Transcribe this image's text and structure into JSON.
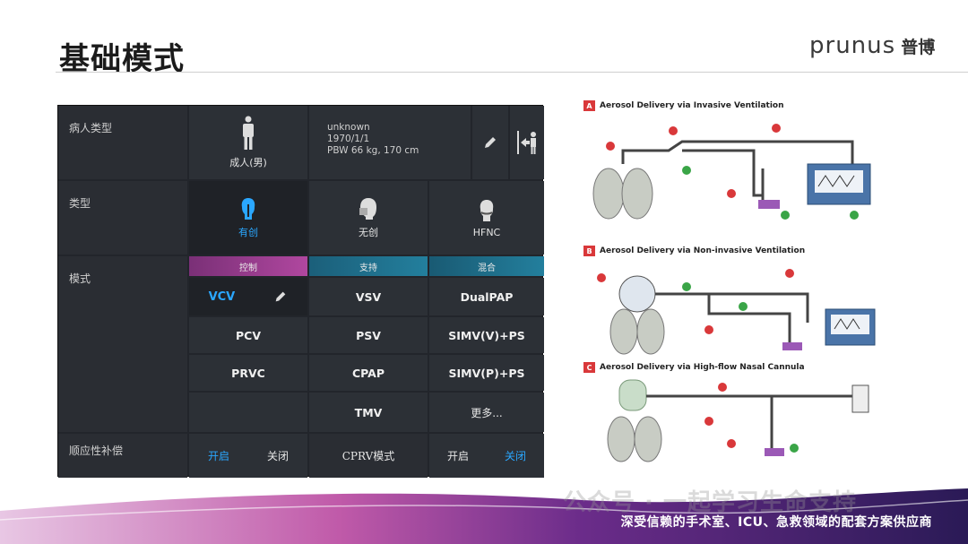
{
  "slide": {
    "title": "基础模式",
    "logo_latin": "prunus",
    "logo_cn": "普博",
    "footer": "深受信赖的手术室、ICU、急救领域的配套方案供应商",
    "watermark": "公众号 · 一起学习生命支持"
  },
  "panel": {
    "row_labels": {
      "patient_type": "病人类型",
      "type": "类型",
      "mode": "模式",
      "compliance": "顺应性补偿"
    },
    "patient": {
      "label": "成人(男)",
      "name": "unknown",
      "dob": "1970/1/1",
      "pbw": "PBW 66 kg, 170 cm"
    },
    "types": [
      "有创",
      "无创",
      "HFNC"
    ],
    "mode_headers": [
      "控制",
      "支持",
      "混合"
    ],
    "modes": {
      "control": [
        "VCV",
        "PCV",
        "PRVC"
      ],
      "support": [
        "VSV",
        "PSV",
        "CPAP",
        "TMV"
      ],
      "mixed": [
        "DualPAP",
        "SIMV(V)+PS",
        "SIMV(P)+PS",
        "更多..."
      ]
    },
    "compliance": {
      "on1": "开启",
      "off1": "关闭",
      "cprv": "CPRV模式",
      "on2": "开启",
      "off2": "关闭"
    },
    "colors": {
      "accent_blue": "#2aa7ff",
      "control_header": "#9b3f93",
      "support_header": "#1f6f8f",
      "mixed_header": "#1c6a86"
    }
  },
  "diagram": {
    "section_a": {
      "badge": "A",
      "title": "Aerosol Delivery via Invasive Ventilation"
    },
    "section_b": {
      "badge": "B",
      "title": "Aerosol Delivery via Non-invasive Ventilation"
    },
    "section_c": {
      "badge": "C",
      "title": "Aerosol Delivery via High-flow Nasal Cannula"
    }
  }
}
